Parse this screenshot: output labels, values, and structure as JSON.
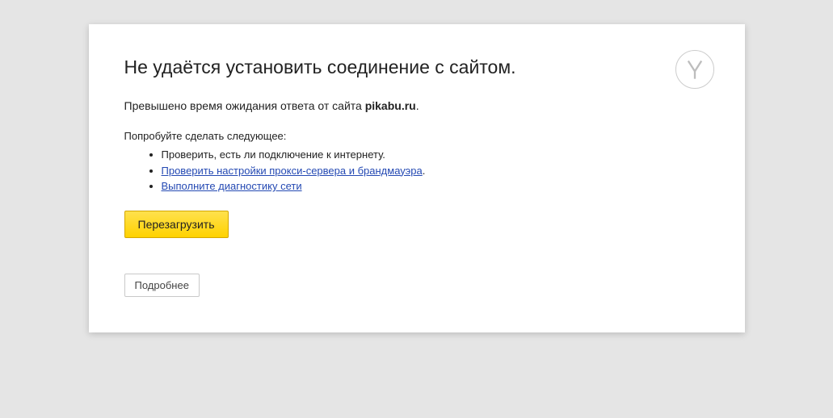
{
  "heading": "Не удаётся установить соединение с сайтом.",
  "subtitle_prefix": "Превышено время ожидания ответа от сайта ",
  "subtitle_domain": "pikabu.ru",
  "subtitle_suffix": ".",
  "try_label": "Попробуйте сделать следующее:",
  "suggestions": {
    "check_connection": "Проверить, есть ли подключение к интернету.",
    "check_proxy_link": "Проверить настройки прокси-сервера и брандмауэра",
    "check_proxy_suffix": ".",
    "diagnostics_link": "Выполните диагностику сети"
  },
  "reload_label": "Перезагрузить",
  "details_label": "Подробнее"
}
